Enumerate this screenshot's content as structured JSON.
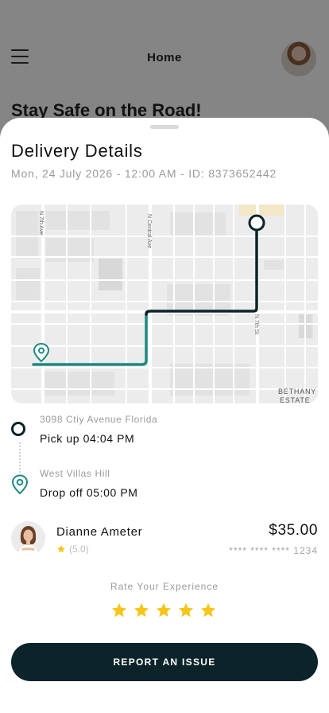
{
  "background": {
    "title": "Home",
    "heading": "Stay Safe on the Road!"
  },
  "sheet": {
    "title": "Delivery Details",
    "subtitle": "Mon, 24 July 2026 - 12:00 AM - ID: 8373652442"
  },
  "map": {
    "street_labels": [
      "N 7th Ave",
      "N Central Ave",
      "N 7th St"
    ],
    "area_label_1": "BETHANY",
    "area_label_2": "ESTATE",
    "route_colors": {
      "pickup_segment": "#0b2329",
      "dropoff_segment": "#1d8a80"
    }
  },
  "pickup": {
    "address": "3098 Ctiy Avenue Florida",
    "time": "Pick up 04:04 PM",
    "icon": "circle-marker-icon"
  },
  "dropoff": {
    "address": "West Villas Hill",
    "time": "Drop off 05:00 PM",
    "icon": "location-pin-icon"
  },
  "driver": {
    "name": "Dianne Ameter",
    "rating": "(5.0)",
    "price": "$35.00",
    "card": "**** **** **** 1234"
  },
  "rating_section": {
    "title": "Rate Your Experience",
    "stars_selected": 5,
    "stars_total": 5
  },
  "actions": {
    "report_label": "REPORT AN ISSUE"
  },
  "colors": {
    "primary": "#0b2329",
    "accent_teal": "#1d8a80",
    "star": "#f5c518"
  }
}
